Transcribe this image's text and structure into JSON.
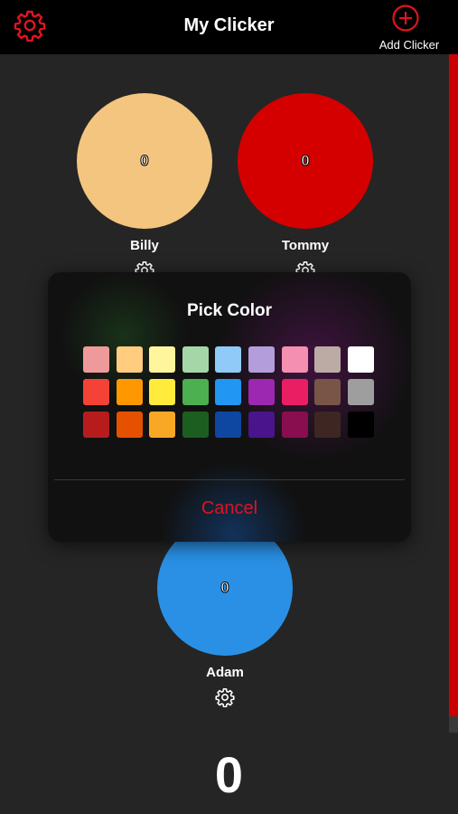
{
  "header": {
    "title": "My Clicker",
    "add_label": "Add Clicker"
  },
  "theme": {
    "accent": "#e0141e",
    "header_bg": "#000000",
    "page_bg": "#252525"
  },
  "clickers": [
    {
      "name": "Billy",
      "count": "0",
      "color": "#f3c57f"
    },
    {
      "name": "Tommy",
      "count": "0",
      "color": "#d40000"
    },
    {
      "name": "Adam",
      "count": "0",
      "color": "#2a90e5"
    }
  ],
  "total": "0",
  "color_picker": {
    "title": "Pick Color",
    "cancel_label": "Cancel",
    "swatches": [
      [
        "#ef9a9a",
        "#ffcc80",
        "#fff59d",
        "#a5d6a7",
        "#90caf9",
        "#b39ddb",
        "#f48fb1",
        "#bcaaa4",
        "#ffffff"
      ],
      [
        "#f44336",
        "#ff9800",
        "#ffeb3b",
        "#4caf50",
        "#2196f3",
        "#9c27b0",
        "#e91e63",
        "#795548",
        "#9e9e9e"
      ],
      [
        "#b71c1c",
        "#e65100",
        "#f9a825",
        "#1b5e20",
        "#0d47a1",
        "#4a148c",
        "#880e4f",
        "#3e2723",
        "#000000"
      ]
    ]
  }
}
